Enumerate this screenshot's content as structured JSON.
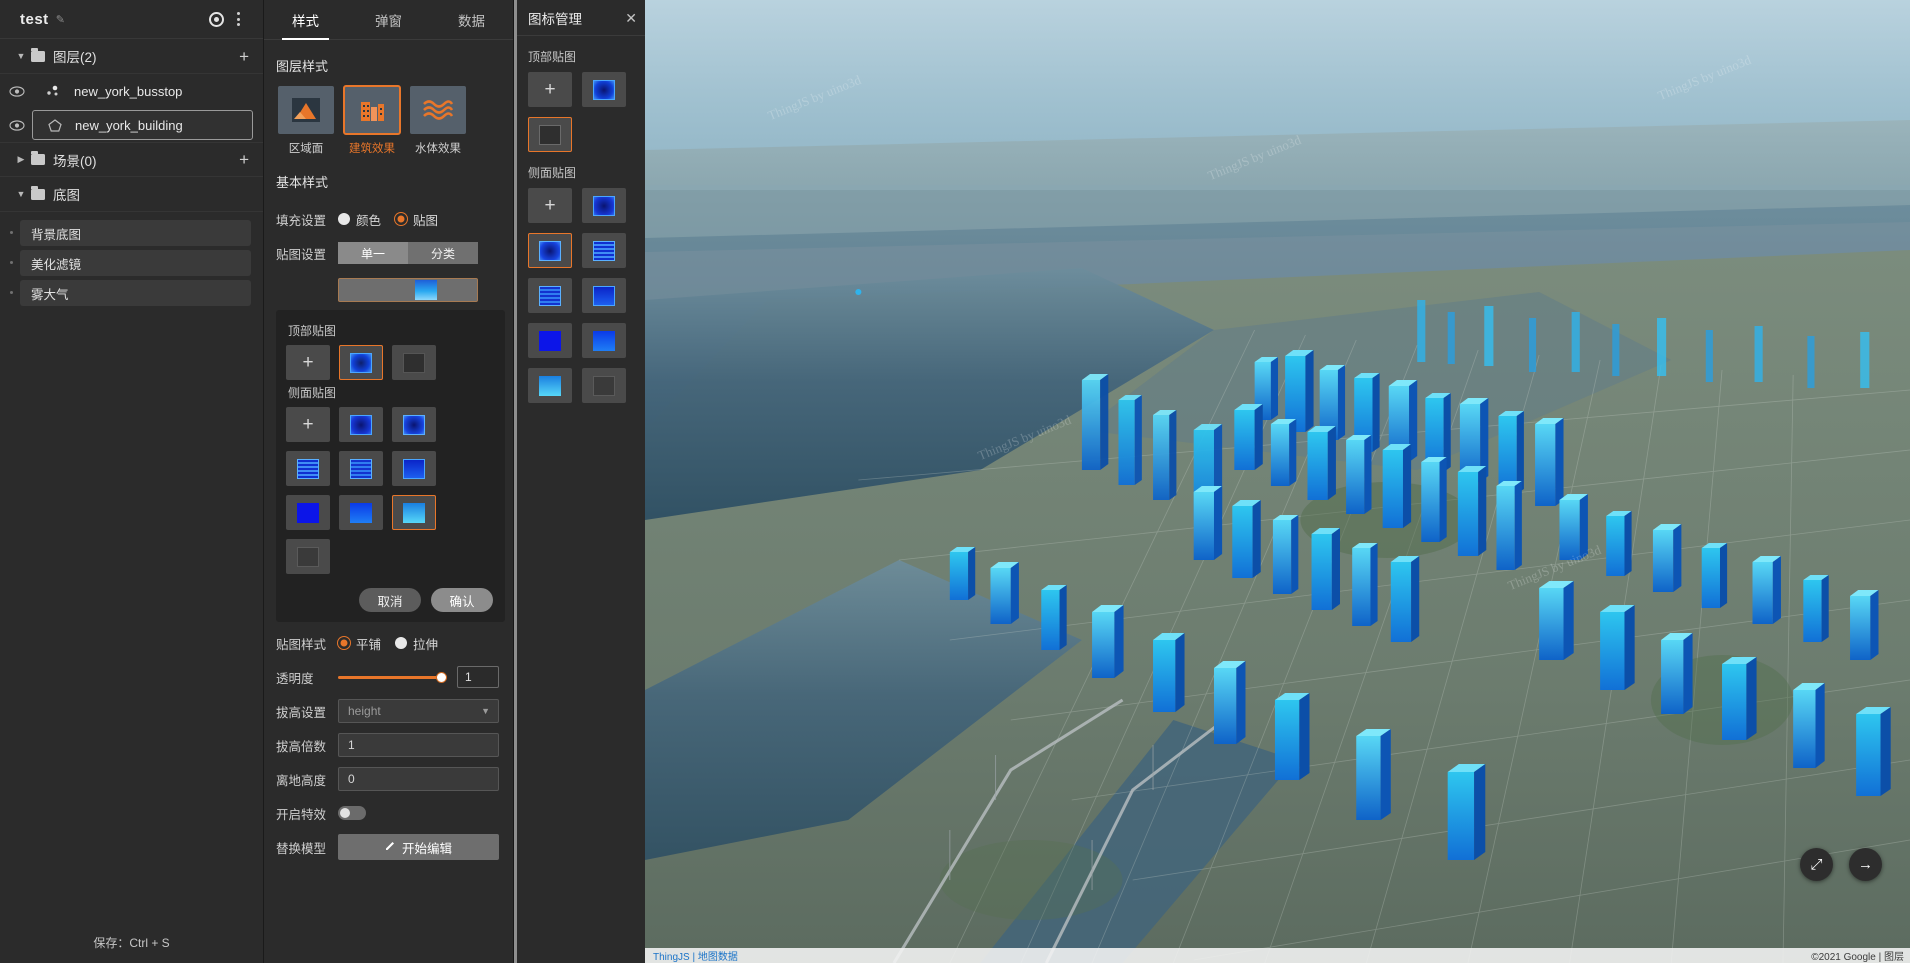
{
  "app": {
    "project_title": "test",
    "save_hint": "保存：Ctrl + S"
  },
  "layer_panel": {
    "groups": [
      {
        "label": "图层(2)",
        "expanded": true,
        "add_label": "+"
      },
      {
        "label": "场景(0)",
        "expanded": false,
        "add_label": "+"
      },
      {
        "label": "底图",
        "expanded": true,
        "add_label": ""
      }
    ],
    "layers": [
      {
        "name": "new_york_busstop",
        "icon": "point-layer-icon",
        "visible": true,
        "selected": false
      },
      {
        "name": "new_york_building",
        "icon": "polygon-layer-icon",
        "visible": true,
        "selected": true
      }
    ],
    "basemap_items": [
      {
        "label": "背景底图"
      },
      {
        "label": "美化滤镜"
      },
      {
        "label": "雾大气"
      }
    ]
  },
  "style_panel": {
    "tabs": [
      {
        "label": "样式",
        "active": true
      },
      {
        "label": "弹窗",
        "active": false
      },
      {
        "label": "数据",
        "active": false
      }
    ],
    "layer_style": {
      "section_title": "图层样式",
      "options": [
        {
          "label": "区域面",
          "icon": "area-polygon-icon",
          "active": false
        },
        {
          "label": "建筑效果",
          "icon": "building-effect-icon",
          "active": true
        },
        {
          "label": "水体效果",
          "icon": "water-effect-icon",
          "active": false
        }
      ]
    },
    "basic_style": {
      "section_title": "基本样式",
      "fill": {
        "label": "填充设置",
        "options": [
          {
            "label": "颜色",
            "selected": false
          },
          {
            "label": "贴图",
            "selected": true
          }
        ]
      },
      "texture": {
        "label": "贴图设置",
        "segments": [
          {
            "label": "单一",
            "selected": true
          },
          {
            "label": "分类",
            "selected": false
          }
        ]
      },
      "texture_popup": {
        "top_label": "顶部贴图",
        "side_label": "侧面贴图",
        "top_items": [
          {
            "type": "add",
            "label": "+",
            "selected": false
          },
          {
            "type": "swatch",
            "selected": true
          },
          {
            "type": "swatch",
            "selected": false
          }
        ],
        "side_items": [
          {
            "type": "add",
            "label": "+",
            "selected": false
          },
          {
            "type": "swatch",
            "selected": false
          },
          {
            "type": "swatch",
            "selected": false
          },
          {
            "type": "swatch",
            "selected": false
          },
          {
            "type": "swatch",
            "selected": false
          },
          {
            "type": "swatch",
            "selected": false
          },
          {
            "type": "swatch",
            "selected": false
          },
          {
            "type": "swatch",
            "selected": false
          },
          {
            "type": "swatch",
            "selected": true
          },
          {
            "type": "swatch",
            "selected": false
          }
        ],
        "cancel_label": "取消",
        "confirm_label": "确认"
      },
      "texture_mode": {
        "label": "贴图样式",
        "options": [
          {
            "label": "平铺",
            "selected": true
          },
          {
            "label": "拉伸",
            "selected": false
          }
        ]
      },
      "opacity": {
        "label": "透明度",
        "value": "1",
        "percent": 100
      },
      "height_field": {
        "label": "拔高设置",
        "value": "height"
      },
      "height_scale": {
        "label": "拔高倍数",
        "value": "1"
      },
      "ground_offset": {
        "label": "离地高度",
        "value": "0"
      },
      "effects": {
        "label": "开启特效",
        "on": false
      },
      "replace_model": {
        "label": "替换模型",
        "button_label": "开始编辑",
        "icon": "pencil-edit-icon"
      }
    }
  },
  "icon_panel": {
    "title": "图标管理",
    "close_label": "✕",
    "top_section_label": "顶部贴图",
    "side_section_label": "侧面贴图",
    "top_items": [
      {
        "type": "add",
        "label": "+",
        "selected": false
      },
      {
        "type": "swatch",
        "selected": false
      },
      {
        "type": "swatch",
        "selected": true
      },
      {
        "type": "empty",
        "selected": false
      }
    ],
    "side_items": [
      {
        "type": "add",
        "label": "+",
        "selected": false
      },
      {
        "type": "swatch",
        "selected": false
      },
      {
        "type": "swatch",
        "selected": true
      },
      {
        "type": "swatch",
        "selected": false
      },
      {
        "type": "swatch",
        "selected": false
      },
      {
        "type": "swatch",
        "selected": false
      },
      {
        "type": "swatch",
        "selected": false
      },
      {
        "type": "swatch",
        "selected": false
      },
      {
        "type": "swatch",
        "selected": false
      },
      {
        "type": "empty",
        "selected": false
      }
    ]
  },
  "map": {
    "nav_buttons": [
      {
        "icon": "expand-arrows-icon",
        "label": "⤢"
      },
      {
        "icon": "arrow-right-icon",
        "label": "→"
      }
    ],
    "attribution_left": "ThingJS | 地图数据",
    "attribution_right": "©2021 Google | 图层",
    "watermark": "ThingJS by uino3d",
    "accent_color": "#e8762a",
    "building_color": "#1f8fe0",
    "water_color": "#3d6478",
    "sky_color": "#a8c6d6"
  }
}
